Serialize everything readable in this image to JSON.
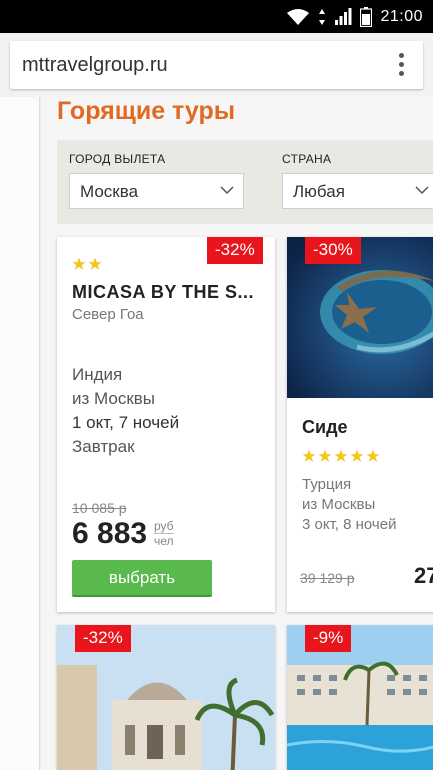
{
  "status_bar": {
    "time": "21:00"
  },
  "browser": {
    "url": "mttravelgroup.ru"
  },
  "page": {
    "title": "Горящие туры",
    "filters": {
      "departure_label": "ГОРОД ВЫЛЕТА",
      "departure_value": "Москва",
      "country_label": "СТРАНА",
      "country_value": "Любая"
    },
    "tours": [
      {
        "discount": "-32%",
        "hotel": "MICASA BY THE S...",
        "region": "Север Гоа",
        "country": "Индия",
        "from": "из Москвы",
        "dates": "1 окт, 7 ночей",
        "meal": "Завтрак",
        "old_price": "10 085 р",
        "price": "6 883",
        "unit_top": "руб",
        "unit_bottom": "чел",
        "button": "выбрать",
        "stars": 2
      },
      {
        "discount": "-30%",
        "hotel": "Сиде",
        "country": "Турция",
        "from": "из Москвы",
        "dates": "3 окт, 8 ночей",
        "old_price": "39 129 р",
        "price_partial": "27",
        "stars": 5
      },
      {
        "discount": "-32%"
      },
      {
        "discount": "-9%"
      }
    ]
  },
  "colors": {
    "accent": "#e06a23",
    "badge": "#e8151c",
    "button": "#5ab94c",
    "star": "#f5c518"
  }
}
